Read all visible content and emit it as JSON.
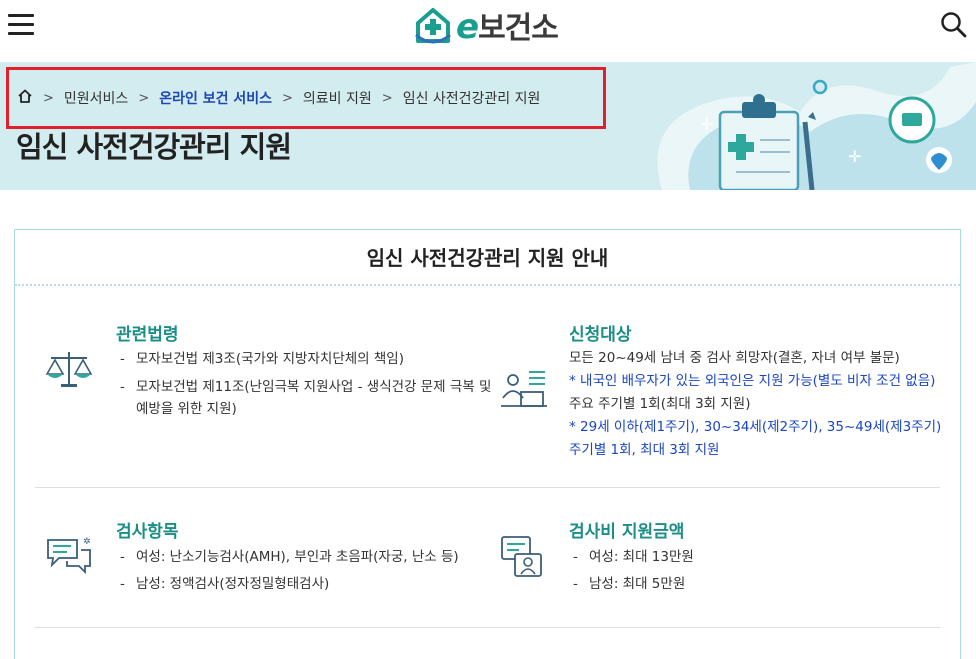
{
  "header": {
    "logo_e": "e",
    "logo_text": "보건소"
  },
  "breadcrumb": {
    "items": [
      "민원서비스",
      "온라인 보건 서비스",
      "의료비 지원",
      "임신 사전건강관리 지원"
    ]
  },
  "page_title": "임신 사전건강관리 지원",
  "panel": {
    "title": "임신 사전건강관리 지원 안내",
    "sections": {
      "law": {
        "heading": "관련법령",
        "items": [
          "모자보건법 제3조(국가와 지방자치단체의 책임)",
          "모자보건법 제11조(난임극복 지원사업 - 생식건강 문제 극복 및 예방을 위한 지원)"
        ]
      },
      "target": {
        "heading": "신청대상",
        "line1": "모든 20~49세 남녀 중 검사 희망자(결혼, 자녀 여부 불문)",
        "line2": "* 내국인 배우자가 있는 외국인은 지원 가능(별도 비자 조건 없음)",
        "line3": "주요 주기별 1회(최대 3회 지원)",
        "line4": "* 29세 이하(제1주기), 30~34세(제2주기), 35~49세(제3주기)",
        "line5": "주기별 1회, 최대 3회 지원"
      },
      "tests": {
        "heading": "검사항목",
        "items": [
          "여성: 난소기능검사(AMH), 부인과 초음파(자궁, 난소 등)",
          "남성: 정액검사(정자정밀형태검사)"
        ]
      },
      "cost": {
        "heading": "검사비 지원금액",
        "items": [
          "여성: 최대 13만원",
          "남성: 최대 5만원"
        ]
      }
    }
  },
  "colors": {
    "accent_teal": "#1b8f86",
    "link_blue": "#1c47b5",
    "hero_bg": "#d3ecf0",
    "highlight_red": "#e0202a"
  },
  "icons": [
    "menu-icon",
    "search-icon",
    "home-icon",
    "scales-icon",
    "consult-icon",
    "chat-icon",
    "support-icon"
  ]
}
